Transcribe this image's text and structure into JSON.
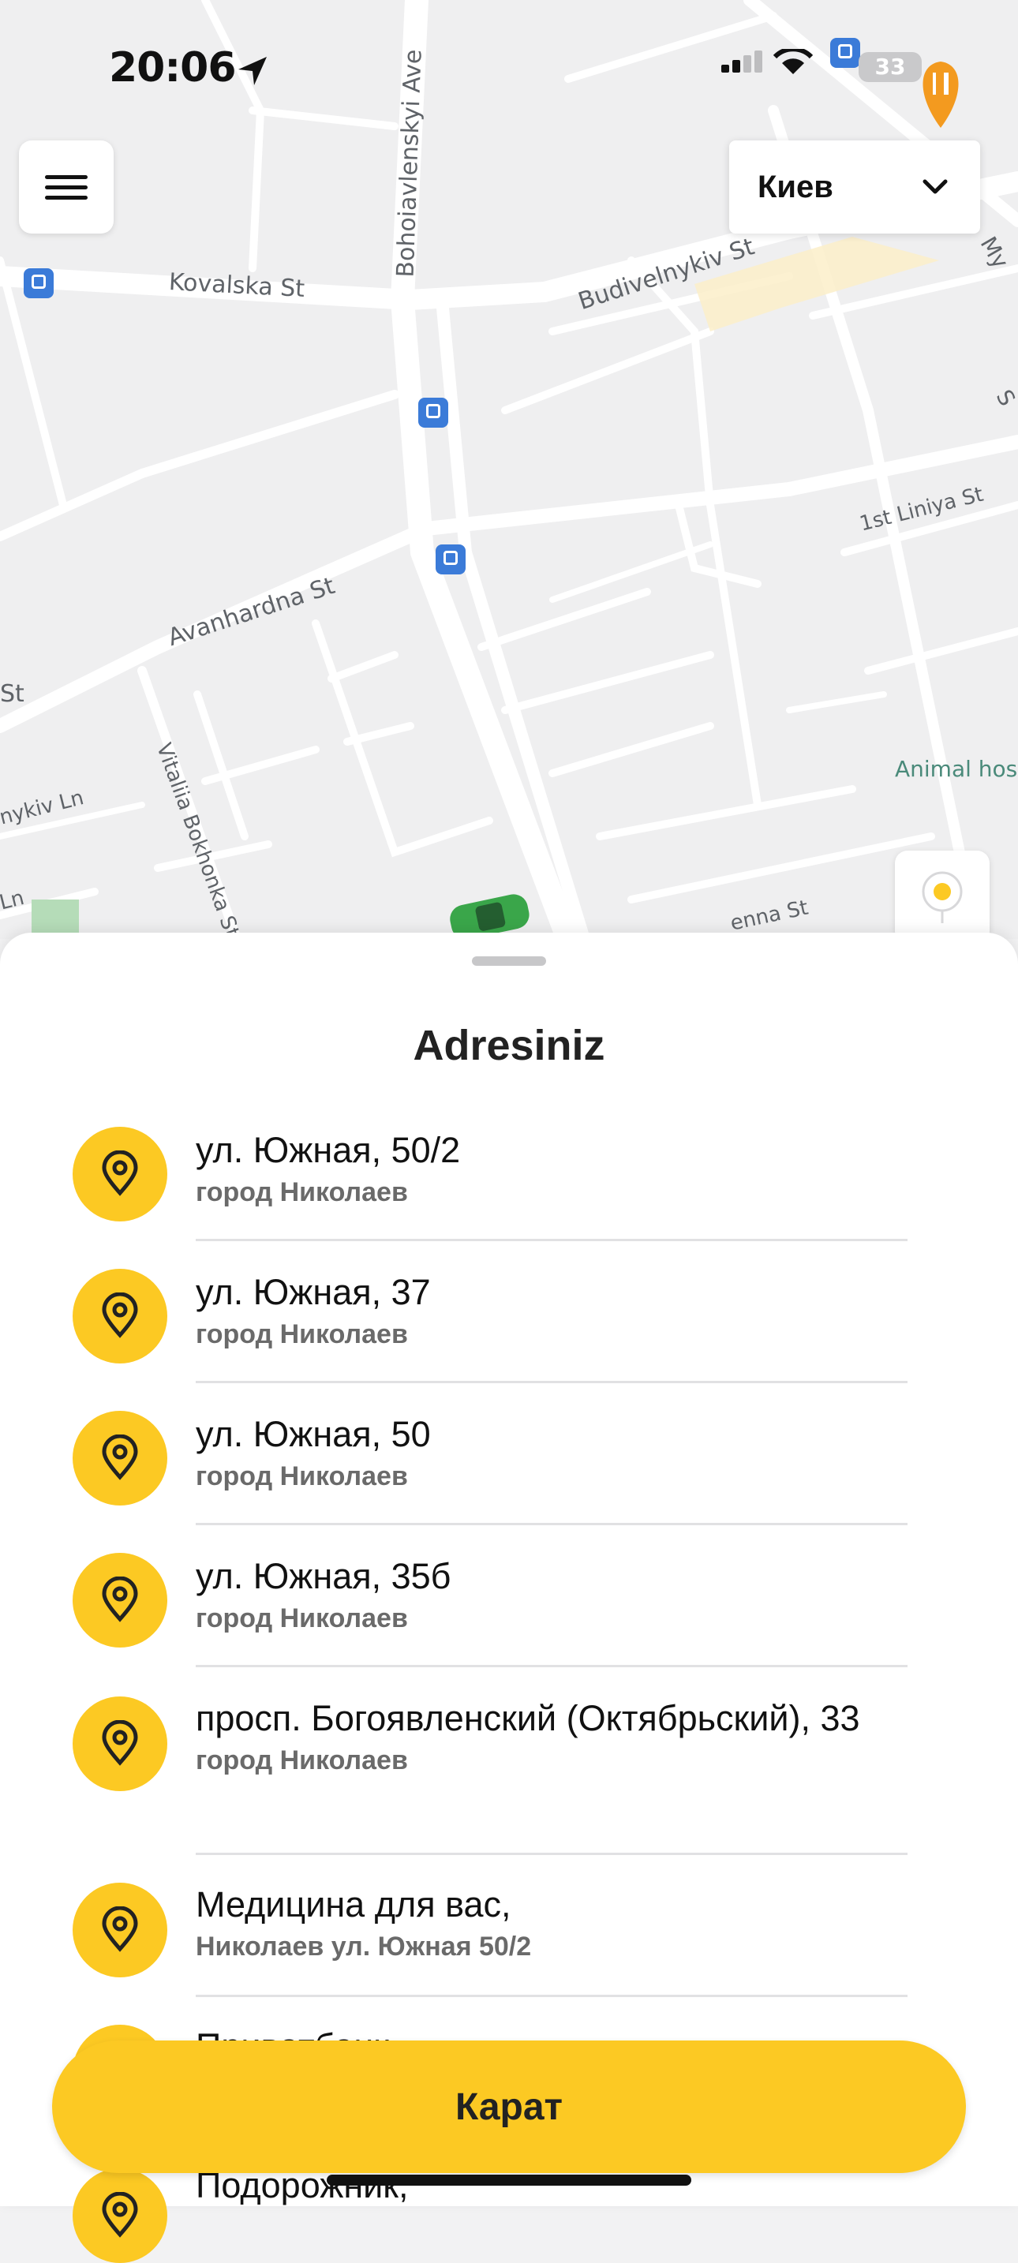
{
  "status_bar": {
    "time": "20:06",
    "battery": "33"
  },
  "map": {
    "street_labels": {
      "bohoiavlenskyi": "Bohoiavlenskyi Ave",
      "kovalska": "Kovalska St",
      "budivelnykiv": "Budivelnykiv St",
      "first_liniya": "1st Liniya St",
      "avanhardna": "Avanhardna St",
      "vitaliia": "Vitaliia Bokhonka St",
      "animal": "Animal hos",
      "st_left": "St",
      "nykiv": "nykiv Ln",
      "ln": "Ln",
      "enna": "enna St",
      "my": "My",
      "s": "S"
    }
  },
  "city_selector": {
    "value": "Киев"
  },
  "sheet": {
    "title": "Adresiniz",
    "items": [
      {
        "title": "ул. Южная, 50/2",
        "subtitle": "город Николаев"
      },
      {
        "title": "ул. Южная, 37",
        "subtitle": "город Николаев"
      },
      {
        "title": "ул. Южная, 50",
        "subtitle": "город Николаев"
      },
      {
        "title": "ул. Южная, 35б",
        "subtitle": "город Николаев"
      },
      {
        "title": "просп. Богоявленский (Октябрьский), 33",
        "subtitle": "город Николаев"
      },
      {
        "title": "Медицина для вас,",
        "subtitle": "Николаев ул. Южная 50/2"
      },
      {
        "title": "Приватбанк,",
        "subtitle": ""
      },
      {
        "title": "Подорожник,",
        "subtitle": ""
      }
    ]
  },
  "cta": {
    "label": "Карат"
  },
  "colors": {
    "accent": "#fcc923",
    "map_bg": "#efeff0",
    "transit": "#3b7bd8",
    "poi": "#f39a1f"
  }
}
